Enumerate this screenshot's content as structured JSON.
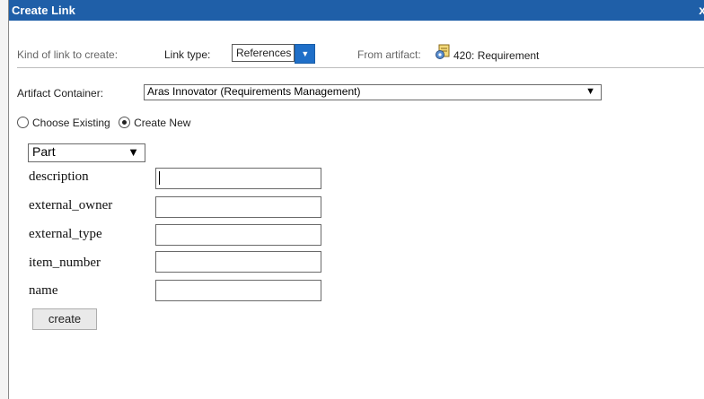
{
  "dialog": {
    "title": "Create Link",
    "close_glyph": "x"
  },
  "toolbar": {
    "kind_label": "Kind of link to create:",
    "link_type_label": "Link type:",
    "link_type_value": "References",
    "from_label": "From artifact:",
    "artifact_icon": "requirement-icon",
    "artifact_text": "420: Requirement"
  },
  "container": {
    "label": "Artifact Container:",
    "value": "Aras Innovator (Requirements Management)"
  },
  "mode": {
    "options": [
      {
        "label": "Choose Existing",
        "selected": false
      },
      {
        "label": "Create New",
        "selected": true
      }
    ]
  },
  "type_select": {
    "value": "Part"
  },
  "fields": [
    {
      "label": "description",
      "value": ""
    },
    {
      "label": "external_owner",
      "value": ""
    },
    {
      "label": "external_type",
      "value": ""
    },
    {
      "label": "item_number",
      "value": ""
    },
    {
      "label": "name",
      "value": ""
    }
  ],
  "create_button": "create",
  "colors": {
    "titlebar": "#1f5fa8",
    "dropdown_button": "#1f6fc8"
  }
}
